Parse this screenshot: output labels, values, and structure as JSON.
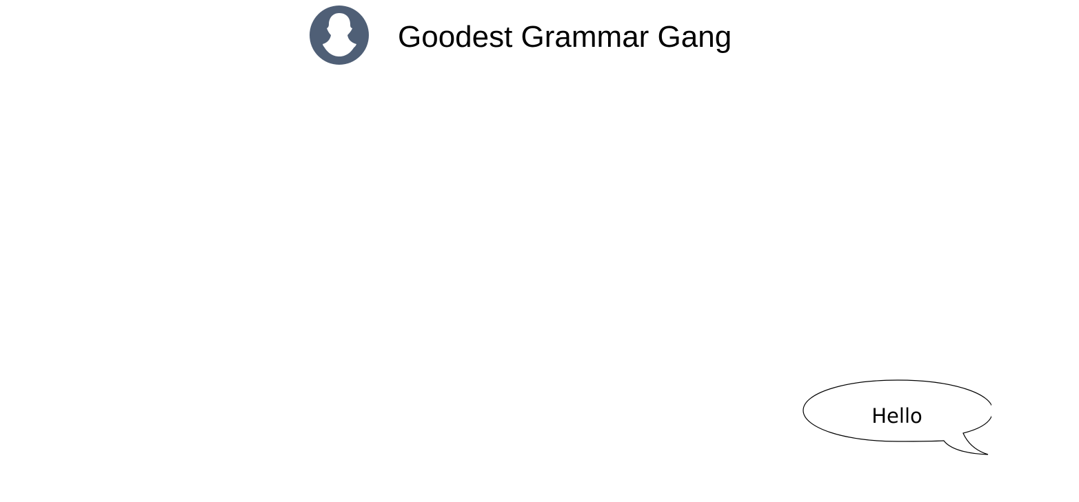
{
  "chat": {
    "title": "Goodest Grammar Gang",
    "avatar_icon": "person-silhouette-icon",
    "avatar_color": "#4f5f76"
  },
  "messages": [
    {
      "text": "Hello",
      "style": "speech-bubble"
    }
  ]
}
